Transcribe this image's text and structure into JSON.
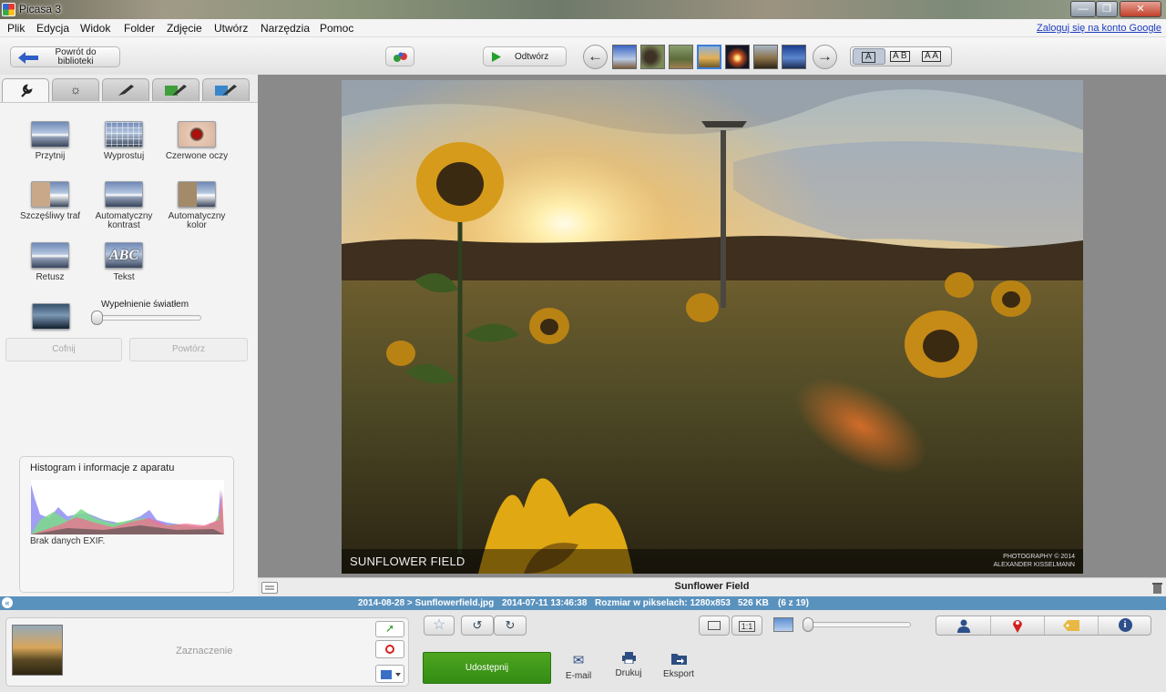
{
  "window": {
    "title": "Picasa 3",
    "minimize": "—",
    "maximize": "❐",
    "close": "✕"
  },
  "menu": {
    "items": [
      "Plik",
      "Edycja",
      "Widok",
      "Folder",
      "Zdjęcie",
      "Utwórz",
      "Narzędzia",
      "Pomoc"
    ],
    "google_link": "Zaloguj się na konto Google"
  },
  "toolbar": {
    "back_label": "Powrót do biblioteki",
    "play_label": "Odtwórz",
    "compare_options": [
      "A",
      "A B",
      "A A"
    ]
  },
  "edit_tabs": {
    "icons": [
      "wrench-icon",
      "sun-icon",
      "brush-icon",
      "brush-green-icon",
      "brush-blue-icon"
    ]
  },
  "tools": {
    "crop": "Przytnij",
    "straighten": "Wyprostuj",
    "redeye": "Czerwone oczy",
    "lucky": "Szczęśliwy traf",
    "auto_contrast": "Automatyczny kontrast",
    "auto_color": "Automatyczny kolor",
    "retouch": "Retusz",
    "text": "Tekst",
    "text_icon": "ABC",
    "fill_light": "Wypełnienie światłem",
    "fill_light_value": 0,
    "undo": "Cofnij",
    "redo": "Powtórz"
  },
  "histogram": {
    "title": "Histogram i informacje z aparatu",
    "exif": "Brak danych EXIF."
  },
  "photo": {
    "overlay_title": "SUNFLOWER FIELD",
    "credit_line1": "PHOTOGRAPHY © 2014",
    "credit_line2": "ALEXANDER KISSELMANN"
  },
  "caption": "Sunflower Field",
  "info": {
    "path": "2014-08-28 > Sunflowerfield.jpg",
    "datetime": "2014-07-11 13:46:38",
    "size": "Rozmiar w pikselach: 1280x853",
    "filesize": "526 KB",
    "position": "(6 z 19)"
  },
  "bottom": {
    "selection_label": "Zaznaczenie",
    "zoom_one_to_one": "1:1",
    "share": "Udostępnij",
    "email": "E-mail",
    "print": "Drukuj",
    "export": "Eksport"
  },
  "colors": {
    "share_green": "#3f8f1a",
    "infobar_blue": "#5a92be",
    "link_blue": "#1a3bbf"
  }
}
